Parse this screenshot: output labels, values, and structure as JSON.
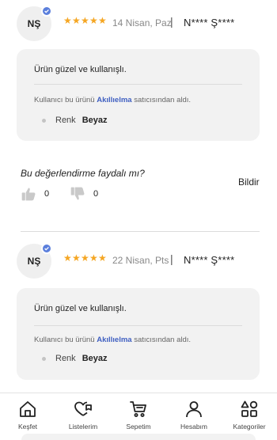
{
  "reviews": [
    {
      "avatar_initials": "NŞ",
      "rating": 5,
      "date": "14 Nisan, Paz",
      "separator": "|",
      "user": "N**** Ş****",
      "text": "Ürün güzel ve kullanışlı.",
      "seller_prefix": "Kullanıcı bu ürünü",
      "seller_name": "Akıllıelma",
      "seller_suffix": "satıcısından aldı.",
      "attr_label": "Renk",
      "attr_value": "Beyaz"
    },
    {
      "avatar_initials": "NŞ",
      "rating": 5,
      "date": "22 Nisan, Pts",
      "separator": "|",
      "user": "N**** Ş****",
      "text": "Ürün güzel ve kullanışlı.",
      "seller_prefix": "Kullanıcı bu ürünü",
      "seller_name": "Akıllıelma",
      "seller_suffix": "satıcısından aldı.",
      "attr_label": "Renk",
      "attr_value": "Beyaz"
    }
  ],
  "helpful": {
    "question": "Bu değerlendirme faydalı mı?",
    "report": "Bildir",
    "likes": "0",
    "dislikes": "0"
  },
  "colors": {
    "star": "#f5a623",
    "verified_badge": "#5b7fdc",
    "seller_link": "#3f5fc1",
    "card_bg": "#f2f2f2"
  },
  "bottom_nav": [
    {
      "label": "Keşfet",
      "icon": "home-icon"
    },
    {
      "label": "Listelerim",
      "icon": "heart-list-icon"
    },
    {
      "label": "Sepetim",
      "icon": "cart-icon"
    },
    {
      "label": "Hesabım",
      "icon": "user-icon"
    },
    {
      "label": "Kategoriler",
      "icon": "categories-icon"
    }
  ]
}
